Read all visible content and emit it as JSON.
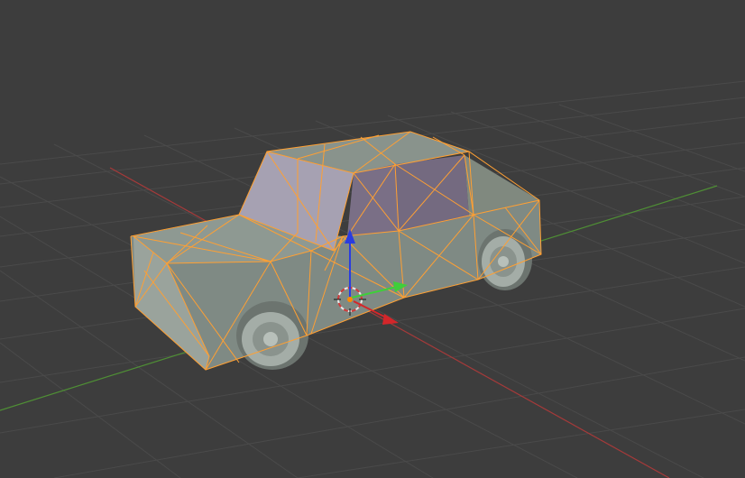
{
  "viewport": {
    "background": "#3d3d3d",
    "grid_color": "#4a4a4a",
    "x_axis_color": "#a53a3a",
    "y_axis_color": "#5a9a3a"
  },
  "object": {
    "name_icon": "car-mesh",
    "selected": true,
    "mode": "edit-wireframe",
    "body_color": "#7f8a84",
    "window_color": "#7a6f86",
    "wire_color": "#ffa033"
  },
  "gizmo": {
    "x_color": "#d4262a",
    "y_color": "#3fcf3a",
    "z_color": "#2a3ce0",
    "cursor_color": "#e8e8e8",
    "pivot_color": "#ff8a00"
  }
}
